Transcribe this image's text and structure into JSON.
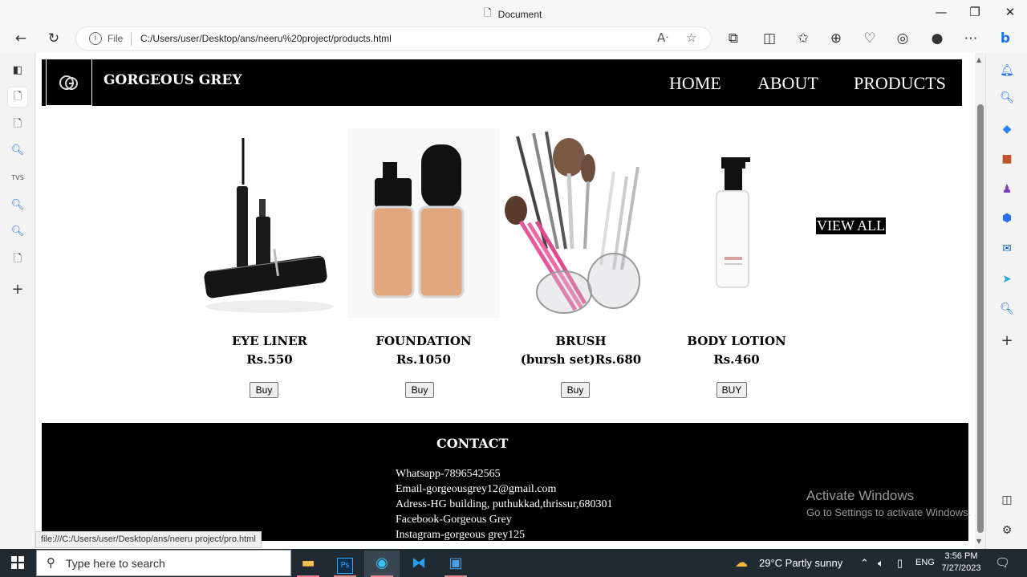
{
  "browser": {
    "tab_title": "Document",
    "address_prefix": "File",
    "url": "C:/Users/user/Desktop/ans/neeru%20project/products.html",
    "status_url": "file:///C:/Users/user/Desktop/ans/neeru project/pro.html"
  },
  "site": {
    "brand": "GORGEOUS GREY",
    "nav": [
      "HOME",
      "ABOUT",
      "PRODUCTS"
    ],
    "products": [
      {
        "name": "EYE LINER",
        "price": "Rs.550",
        "buy": "Buy"
      },
      {
        "name": "FOUNDATION",
        "price": "Rs.1050",
        "buy": "Buy"
      },
      {
        "name": "BRUSH",
        "price": "(bursh set)Rs.680",
        "buy": "Buy"
      },
      {
        "name": "BODY LOTION",
        "price": "Rs.460",
        "buy": "BUY"
      }
    ],
    "view_all": "VIEW ALL",
    "contact": {
      "title": "CONTACT",
      "lines": [
        "Whatsapp-7896542565",
        "Email-gorgeousgrey12@gmail.com",
        "Adress-HG building, puthukkad,thrissur,680301",
        "Facebook-Gorgeous Grey",
        "Instagram-gorgeous grey125"
      ]
    }
  },
  "watermark": {
    "line1": "Activate Windows",
    "line2": "Go to Settings to activate Windows."
  },
  "taskbar": {
    "search_placeholder": "Type here to search",
    "weather": "29°C  Partly sunny",
    "language": "ENG",
    "time": "3:56 PM",
    "date": "7/27/2023"
  }
}
